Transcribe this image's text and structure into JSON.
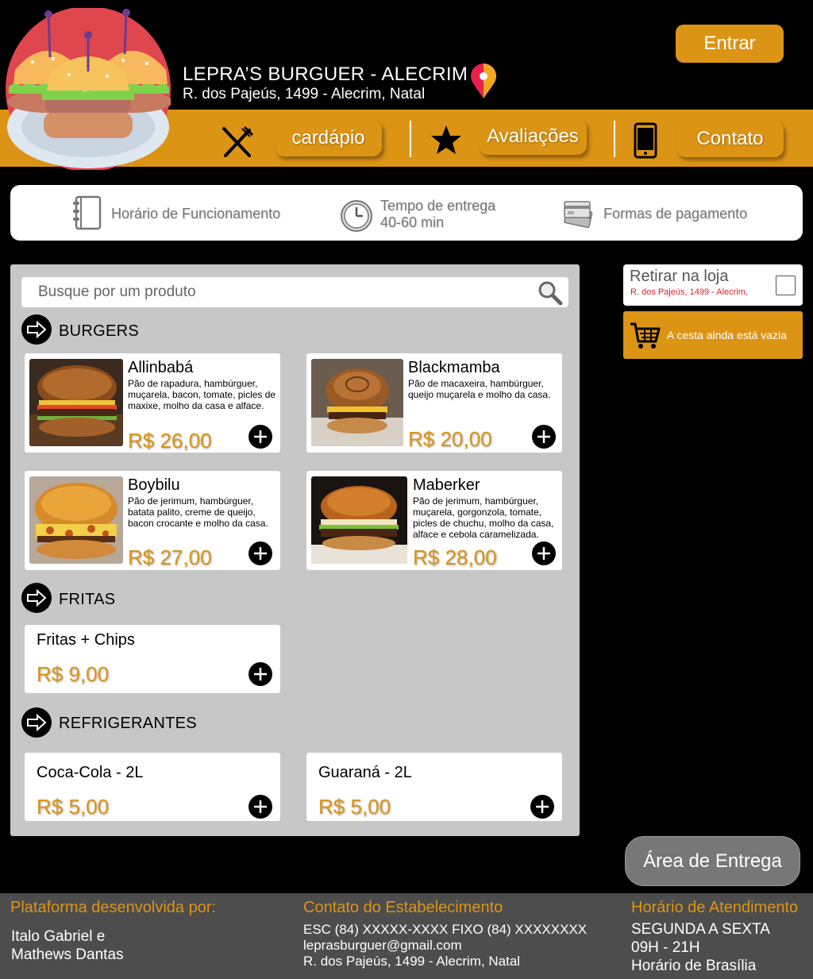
{
  "header": {
    "restaurant_name": "LEPRA’S BURGUER - ALECRIM",
    "address": "R. dos Pajeús, 1499 - Alecrim, Natal",
    "login_label": "Entrar"
  },
  "nav": {
    "menu_label": "cardápio",
    "reviews_label": "Avaliações",
    "contact_label": "Contato"
  },
  "info": {
    "hours_label": "Horário de Funcionamento",
    "delivery_time_label": "Tempo de entrega",
    "delivery_time_value": "40-60 min",
    "payment_label": "Formas de pagamento"
  },
  "search": {
    "placeholder": "Busque por um produto"
  },
  "categories": [
    {
      "title": "BURGERS",
      "items": [
        {
          "name": "Allinbabá",
          "description": "Pão de rapadura, hambúrguer, muçarela, bacon, tomate, picles de maxixe, molho da casa e alface.",
          "price": "R$ 26,00"
        },
        {
          "name": "Blackmamba",
          "description": "Pão de macaxeira, hambúrguer, queijo muçarela e molho da casa.",
          "price": "R$ 20,00"
        },
        {
          "name": "Boybilu",
          "description": "Pão de jerimum, hambúrguer, batata palito, creme de queijo, bacon crocante e molho da casa.",
          "price": "R$ 27,00"
        },
        {
          "name": "Maberker",
          "description": "Pão de jerimum, hambúrguer, muçarela, gorgonzola, tomate, picles de chuchu, molho da casa, alface e cebola caramelizada.",
          "price": "R$ 28,00"
        }
      ]
    },
    {
      "title": "FRITAS",
      "items": [
        {
          "name": "Fritas + Chips",
          "price": "R$ 9,00"
        }
      ]
    },
    {
      "title": "REFRIGERANTES",
      "items": [
        {
          "name": "Coca-Cola - 2L",
          "price": "R$ 5,00"
        },
        {
          "name": "Guaraná - 2L",
          "price": "R$ 5,00"
        }
      ]
    }
  ],
  "pickup": {
    "label": "Retirar na loja",
    "address": "R. dos Pajeús, 1499 - Alecrim,"
  },
  "cart": {
    "empty_label": "A cesta ainda está vazia"
  },
  "delivery_area_label": "Área de Entrega",
  "footer": {
    "developed_title": "Plataforma desenvolvida por:",
    "developers_line1": "Italo Gabriel e",
    "developers_line2": "Mathews Dantas",
    "contact_title": "Contato do Estabelecimento",
    "contact_phones": "ESC (84) XXXXX-XXXX FIXO (84) XXXXXXXX",
    "contact_email": "leprasburguer@gmail.com",
    "contact_address": "R. dos Pajeús, 1499 - Alecrim, Natal",
    "hours_title": "Horário de Atendimento",
    "hours_days": "SEGUNDA A SEXTA",
    "hours_time": "09H - 21H",
    "hours_zone": "Horário de Brasília"
  },
  "colors": {
    "accent": "#dc9415",
    "panel": "#c7c7c7",
    "footer": "#4d4d4d",
    "pickup_address": "#d9202c"
  }
}
